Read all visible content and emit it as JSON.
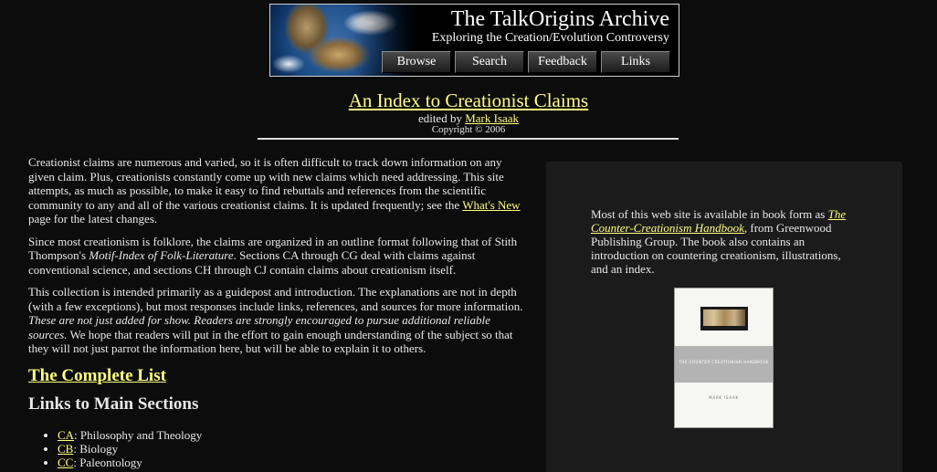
{
  "banner": {
    "title": "The TalkOrigins Archive",
    "subtitle": "Exploring the Creation/Evolution Controversy",
    "nav": [
      "Browse",
      "Search",
      "Feedback",
      "Links"
    ]
  },
  "header": {
    "title": "An Index to Creationist Claims",
    "edited_prefix": "edited by ",
    "editor": "Mark Isaak",
    "copyright": "Copyright © 2006"
  },
  "intro": {
    "p1_text": "Creationist claims are numerous and varied, so it is often difficult to track down information on any given claim. Plus, creationists constantly come up with new claims which need addressing. This site attempts, as much as possible, to make it easy to find rebuttals and references from the scientific community to any and all of the various creationist claims. It is updated frequently; see the ",
    "p1_link": "What's New",
    "p1_end": " page for the latest changes.",
    "p2_start": "Since most creationism is folklore, the claims are organized in an outline format following that of Stith Thompson's ",
    "p2_italic": "Motif-Index of Folk-Literature",
    "p2_end": ". Sections CA through CG deal with claims against conventional science, and sections CH through CJ contain claims about creationism itself.",
    "p3_start": "This collection is intended primarily as a guidepost and introduction. The explanations are not in depth (with a few exceptions), but most responses include links, references, and sources for more information. ",
    "p3_italic": "These are not just added for show. Readers are strongly encouraged to pursue additional reliable sources.",
    "p3_end": " We hope that readers will put in the effort to gain enough understanding of the subject so that they will not just parrot the information here, but will be able to explain it to others."
  },
  "complete_list": "The Complete List",
  "links_heading": "Links to Main Sections",
  "sections": [
    {
      "code": "CA",
      "label": ": Philosophy and Theology"
    },
    {
      "code": "CB",
      "label": ": Biology"
    },
    {
      "code": "CC",
      "label": ": Paleontology"
    }
  ],
  "sidebar": {
    "text_start": "Most of this web site is available in book form as ",
    "book_link": "The Counter-Creationism Handbook",
    "text_end": ", from Greenwood Publishing Group. The book also contains an introduction on countering creationism, illustrations, and an index.",
    "cover_title": "THE COUNTER-CREATIONISM HANDBOOK",
    "cover_author": "MARK ISAAK"
  }
}
